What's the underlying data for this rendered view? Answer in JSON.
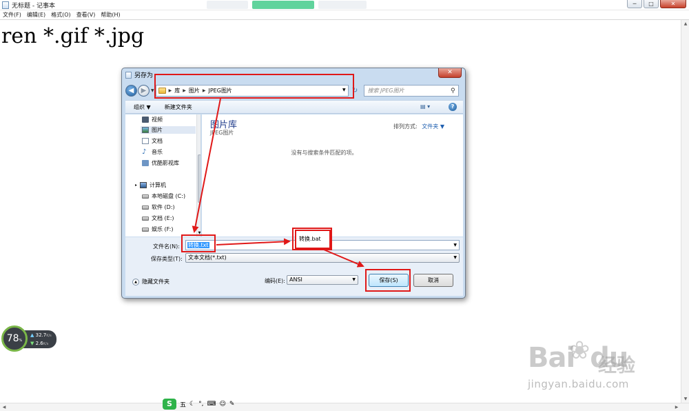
{
  "notepad": {
    "title": "无标题 - 记事本",
    "menu": [
      "文件(F)",
      "编辑(E)",
      "格式(O)",
      "查看(V)",
      "帮助(H)"
    ],
    "content": "ren *.gif *.jpg",
    "window_buttons": {
      "minimize": "─",
      "maximize": "□",
      "close": "✕"
    }
  },
  "dialog": {
    "title": "另存为",
    "close": "✕",
    "breadcrumb": [
      "库",
      "图片",
      "JPEG图片"
    ],
    "search_placeholder": "搜索 JPEG图片",
    "toolbar": {
      "organize": "组织 ▼",
      "new_folder": "新建文件夹"
    },
    "nav_items": [
      {
        "label": "视频",
        "icon": "video-icon"
      },
      {
        "label": "图片",
        "icon": "picture-icon"
      },
      {
        "label": "文档",
        "icon": "document-icon"
      },
      {
        "label": "音乐",
        "icon": "music-icon"
      },
      {
        "label": "优酷影视库",
        "icon": "library-icon"
      }
    ],
    "computer": {
      "label": "计算机",
      "drives": [
        "本地磁盘 (C:)",
        "软件 (D:)",
        "文档 (E:)",
        "娱乐 (F:)"
      ]
    },
    "library": {
      "title": "图片库",
      "subtitle": "JPEG图片",
      "arrange_label": "排列方式:",
      "arrange_value": "文件夹 ▼",
      "empty_message": "没有与搜索条件匹配的项。"
    },
    "filename_label": "文件名(N):",
    "filename_value": "转换.txt",
    "filetype_label": "保存类型(T):",
    "filetype_value": "文本文档(*.txt)",
    "hide_folders": "隐藏文件夹",
    "encoding_label": "编码(E):",
    "encoding_value": "ANSI",
    "save_button": "保存(S)",
    "cancel_button": "取消"
  },
  "annotation": {
    "new_filename": "转换.bat"
  },
  "speed_widget": {
    "percent": "78",
    "percent_unit": "%",
    "upload": "32.7",
    "download": "2.6",
    "unit": "K/s"
  },
  "ime_bar": {
    "logo": "S",
    "mode": "五"
  },
  "watermark": {
    "brand_latin": "Bai",
    "brand_tail": "du",
    "brand_cn": "经验",
    "url": "jingyan.baidu.com"
  },
  "colors": {
    "annotation_red": "#e01818",
    "selection_blue": "#3399ff",
    "dialog_frame": "#c9dcf0"
  }
}
